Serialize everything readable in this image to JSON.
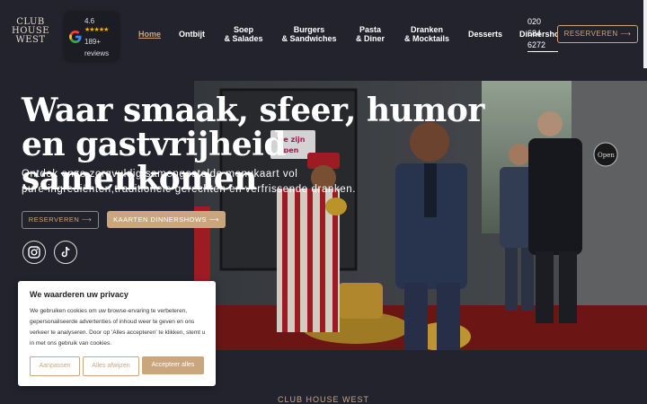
{
  "header": {
    "logo_lines": [
      "CLUB",
      "HOUSE",
      "WEST"
    ],
    "google": {
      "rating": "4.6",
      "stars": "★★★★★",
      "count": "189+",
      "reviews": "reviews"
    },
    "nav": [
      {
        "line1": "Home",
        "line2": "",
        "active": true
      },
      {
        "line1": "Ontbijt",
        "line2": ""
      },
      {
        "line1": "Soep",
        "line2": "& Salades"
      },
      {
        "line1": "Burgers",
        "line2": "& Sandwiches"
      },
      {
        "line1": "Pasta",
        "line2": "& Diner"
      },
      {
        "line1": "Dranken",
        "line2": "& Mocktails"
      },
      {
        "line1": "Desserts",
        "line2": ""
      },
      {
        "line1": "Dinnershows",
        "line2": ""
      }
    ],
    "phone": [
      "020",
      "684",
      "6272"
    ],
    "reserve_label": "RESERVEREN ⟶"
  },
  "hero": {
    "title_line1": "Waar smaak, sfeer, humor",
    "title_line2": "en gastvrijheid samenkomen",
    "sub_line1": "Ontdek onze zorgvuldig samengestelde menukaart vol",
    "sub_line2": "pure ingrediënten,traditionele gerechten en verfrissende dranken.",
    "reserve_btn": "RESERVEREN ⟶",
    "dinnershows_btn": "KAARTEN DINNERSHOWS ⟶",
    "photo_sign_1": "we zijn",
    "photo_sign_2": "open",
    "photo_open_sign": "Open"
  },
  "cookie": {
    "title": "We waarderen uw privacy",
    "text": "We gebruiken cookies om uw browse-ervaring te verbeteren, gepersonaliseerde advertenties of inhoud weer te geven en ons verkeer te analyseren. Door op 'Alles accepteren' te klikken, stemt u in met ons gebruik van cookies.",
    "customize": "Aanpassen",
    "reject": "Alles afwijzen",
    "accept": "Accepteer alles"
  },
  "section_label": "CLUB HOUSE WEST",
  "colors": {
    "background": "#23232e",
    "accent": "#c9a67d"
  }
}
